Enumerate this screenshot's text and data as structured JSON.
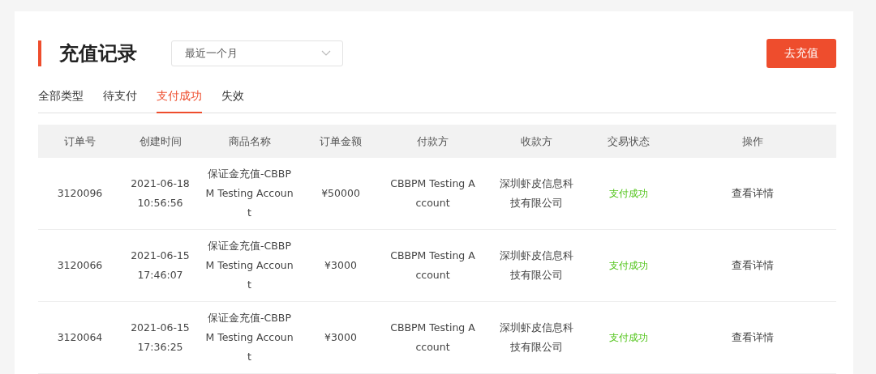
{
  "page": {
    "title": "充值记录",
    "period_select": {
      "value": "最近一个月"
    },
    "action_button": "去充值"
  },
  "tabs": [
    {
      "label": "全部类型",
      "selected": false
    },
    {
      "label": "待支付",
      "selected": false
    },
    {
      "label": "支付成功",
      "selected": true
    },
    {
      "label": "失效",
      "selected": false
    }
  ],
  "table": {
    "columns": [
      "订单号",
      "创建时间",
      "商品名称",
      "订单金额",
      "付款方",
      "收款方",
      "交易状态",
      "操作"
    ],
    "rows": [
      {
        "order_no": "3120096",
        "created": "2021-06-18 10:56:56",
        "product": "保证金充值-CBBPM Testing Account",
        "amount": "¥50000",
        "payer": "CBBPM Testing Account",
        "payee": "深圳虾皮信息科技有限公司",
        "status": {
          "text": "支付成功",
          "color": "#52c41a"
        },
        "action": "查看详情"
      },
      {
        "order_no": "3120066",
        "created": "2021-06-15 17:46:07",
        "product": "保证金充值-CBBPM Testing Account",
        "amount": "¥3000",
        "payer": "CBBPM Testing Account",
        "payee": "深圳虾皮信息科技有限公司",
        "status": {
          "text": "支付成功",
          "color": "#52c41a"
        },
        "action": "查看详情"
      },
      {
        "order_no": "3120064",
        "created": "2021-06-15 17:36:25",
        "product": "保证金充值-CBBPM Testing Account",
        "amount": "¥3000",
        "payer": "CBBPM Testing Account",
        "payee": "深圳虾皮信息科技有限公司",
        "status": {
          "text": "支付成功",
          "color": "#52c41a"
        },
        "action": "查看详情"
      }
    ]
  }
}
